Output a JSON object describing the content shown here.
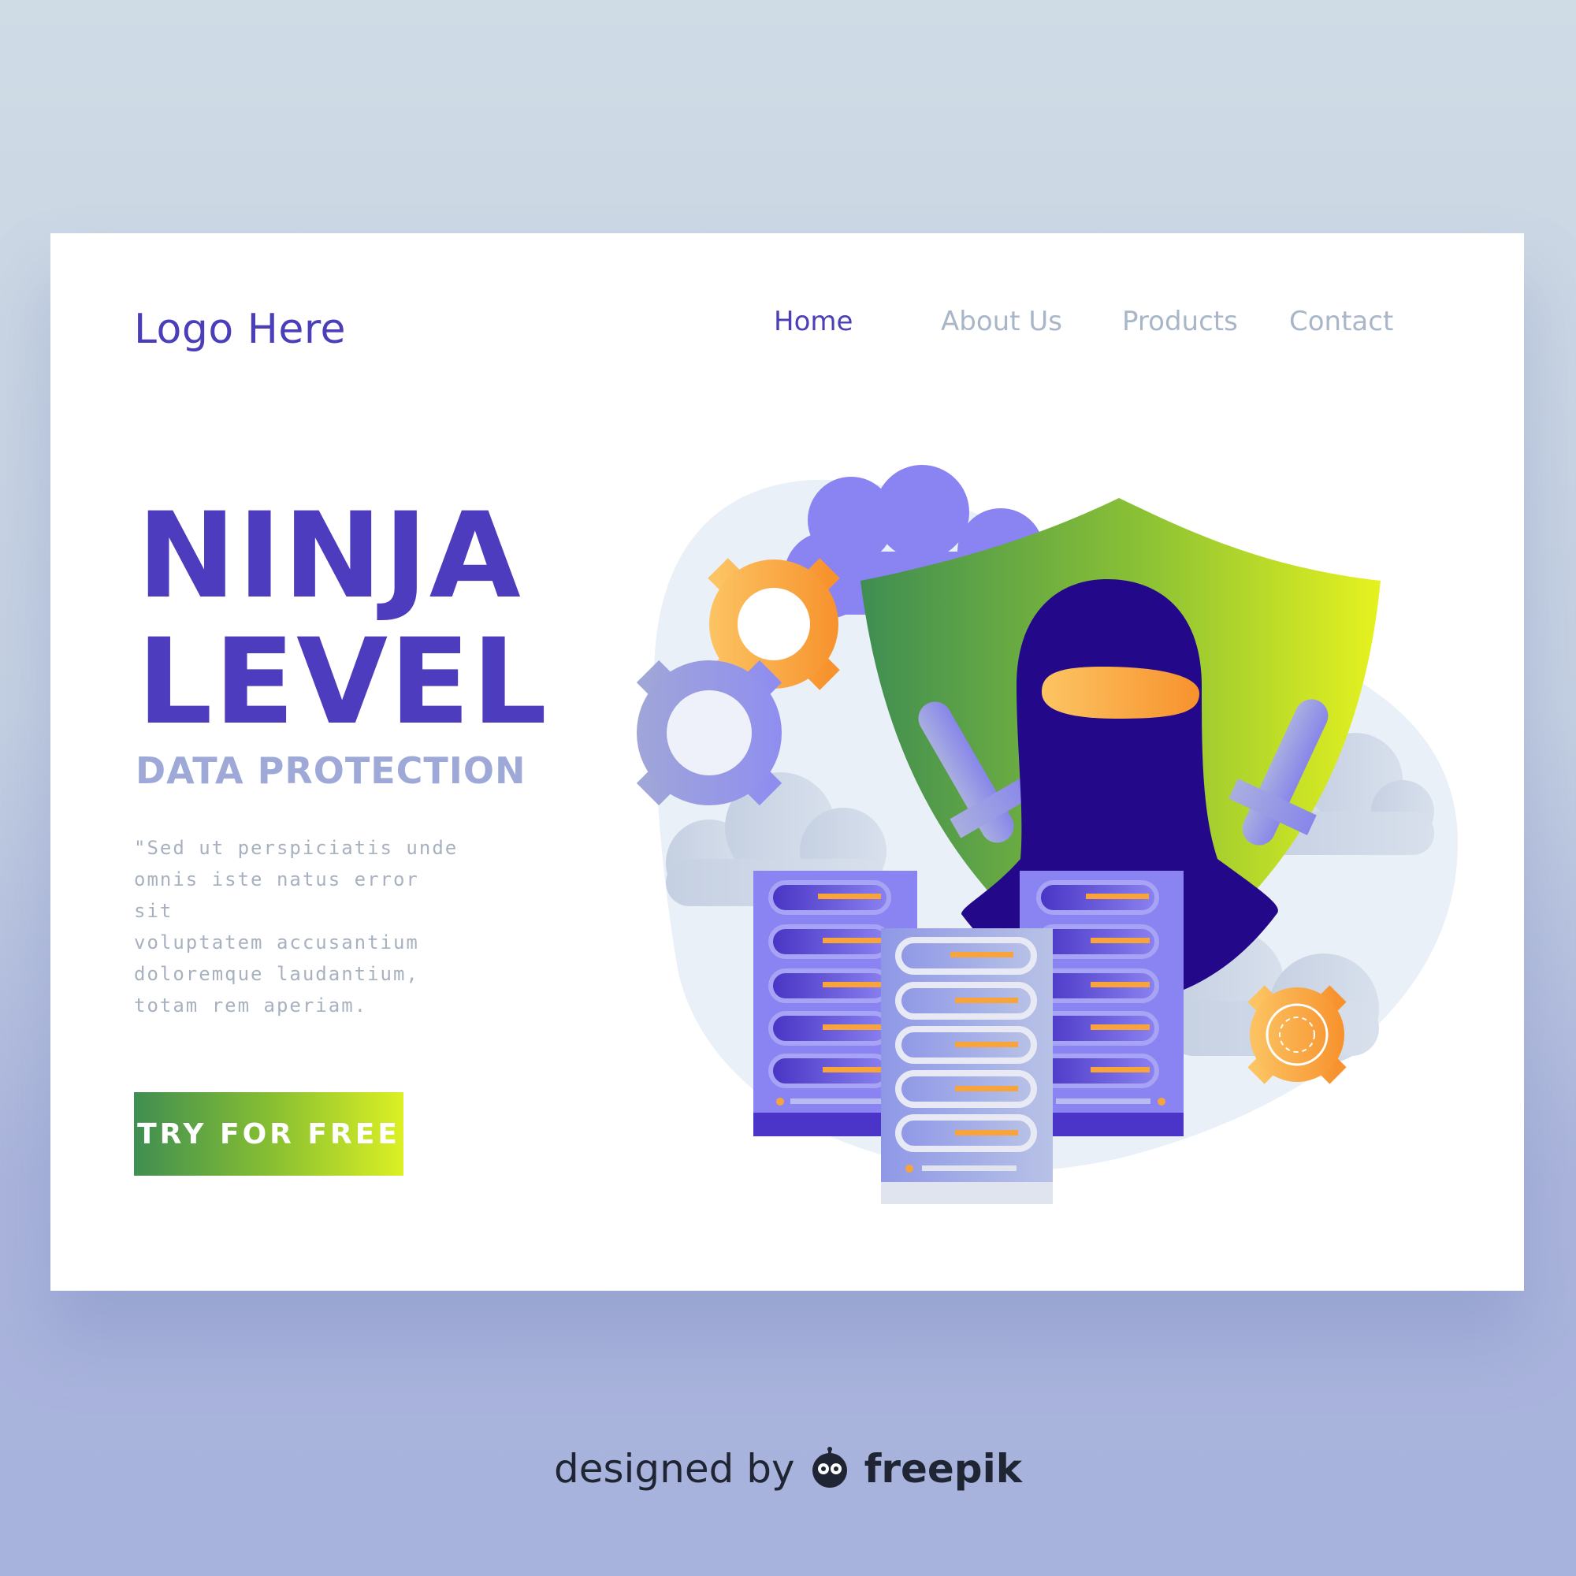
{
  "header": {
    "logo": "Logo Here",
    "nav": [
      {
        "label": "Home",
        "active": true
      },
      {
        "label": "About Us",
        "active": false
      },
      {
        "label": "Products",
        "active": false
      },
      {
        "label": "Contact",
        "active": false
      }
    ]
  },
  "hero": {
    "title_line1": "NINJA",
    "title_line2": "LEVEL",
    "subtitle": "DATA PROTECTION",
    "body_lines": [
      "\"Sed ut perspiciatis unde",
      "omnis iste natus error sit",
      "voluptatem accusantium",
      "doloremque laudantium,",
      "totam rem aperiam."
    ],
    "cta_label": "TRY FOR FREE"
  },
  "illustration": {
    "icons": [
      "ninja-icon",
      "shield-icon",
      "gear-icon",
      "cloud-icon",
      "server-icon",
      "sword-icon"
    ]
  },
  "credit": {
    "prefix": "designed by",
    "brand": "freepik"
  },
  "colors": {
    "primary": "#4a3fb9",
    "nav_inactive": "#a8b6c8",
    "subtitle": "#9ea9d8",
    "cta_gradient_start": "#3f8e52",
    "cta_gradient_end": "#dcf024",
    "accent_orange": "#f9a43a"
  }
}
